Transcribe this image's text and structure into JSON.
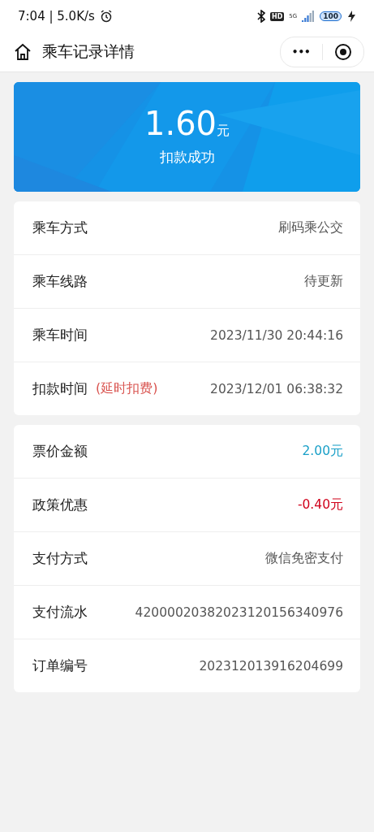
{
  "status_bar": {
    "time": "7:04 | 5.0K/s",
    "hd": "HD",
    "network": "5G",
    "battery": "100"
  },
  "nav": {
    "title": "乘车记录详情",
    "more": "•••"
  },
  "summary": {
    "amount": "1.60",
    "unit": "元",
    "status": "扣款成功"
  },
  "sections": [
    {
      "rows": [
        {
          "label": "乘车方式",
          "value": "刷码乘公交",
          "color": "#555555"
        },
        {
          "label": "乘车线路",
          "value": "待更新",
          "color": "#555555"
        },
        {
          "label": "乘车时间",
          "value": "2023/11/30 20:44:16",
          "color": "#555555"
        },
        {
          "label": "扣款时间",
          "note": "(延时扣费)",
          "value": "2023/12/01 06:38:32",
          "color": "#555555"
        }
      ]
    },
    {
      "rows": [
        {
          "label": "票价金额",
          "value": "2.00元",
          "color": "#1aa0c8"
        },
        {
          "label": "政策优惠",
          "value": "-0.40元",
          "color": "#d0021b"
        },
        {
          "label": "支付方式",
          "value": "微信免密支付",
          "color": "#555555"
        },
        {
          "label": "支付流水",
          "value": "42000020382023120156340976",
          "color": "#555555"
        },
        {
          "label": "订单编号",
          "value": "202312013916204699",
          "color": "#555555"
        }
      ]
    }
  ]
}
